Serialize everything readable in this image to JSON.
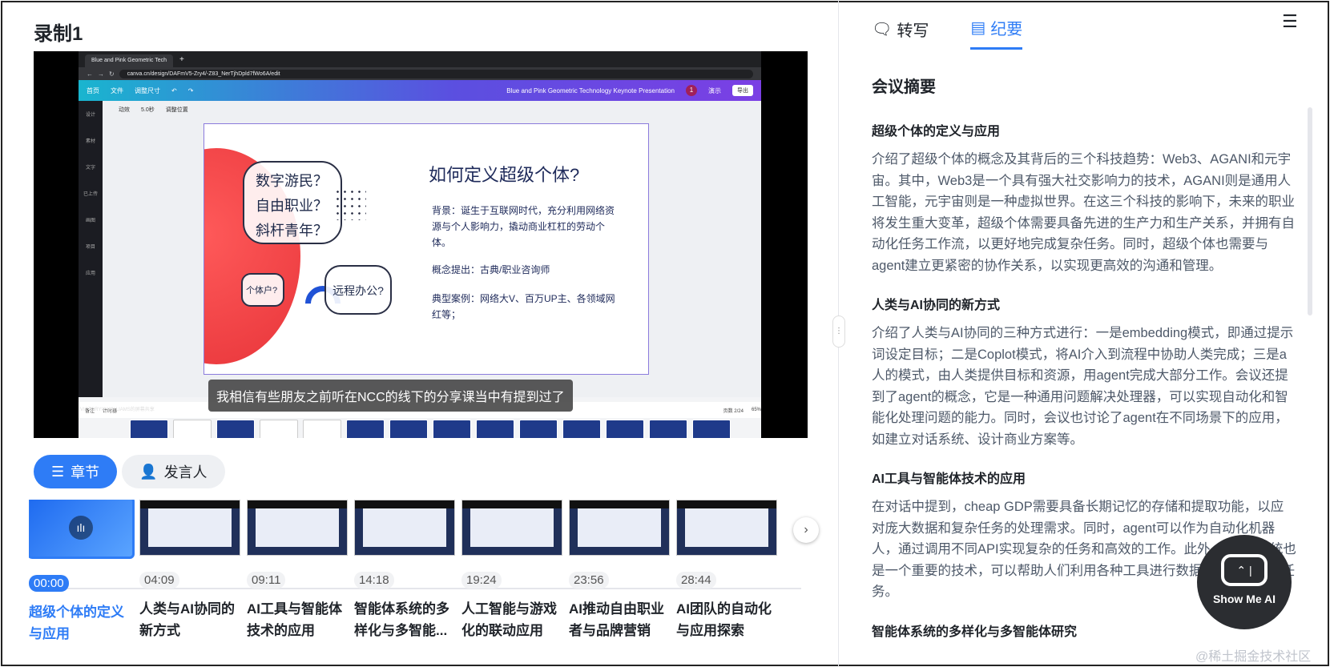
{
  "page": {
    "title": "录制1"
  },
  "browser": {
    "tab_title": "Blue and Pink Geometric Tech",
    "url": "canva.cn/design/DAFmV5-Zry4/-Z83_NerTjhDpld7fWo6A/edit",
    "toolbar": {
      "home": "首页",
      "file": "文件",
      "resize": "调整尺寸",
      "doc_title": "Blue and Pink Geometric Technology Keynote Presentation",
      "collab_count": "1",
      "present": "演示",
      "export": "导出"
    },
    "side_tools": [
      "设计",
      "素材",
      "文字",
      "已上传",
      "画图",
      "项目",
      "应用"
    ],
    "canvas_tools": {
      "animate": "动效",
      "duration": "5.0秒",
      "position": "调整位置"
    },
    "slide": {
      "bubble_lines": [
        "数字游民？",
        "自由职业？",
        "斜杆青年？"
      ],
      "small_bubble": "个体户?",
      "mid_bubble": "远程办公?",
      "heading": "如何定义超级个体?",
      "background": "背景：诞生于互联网时代，充分利用网络资源与个人影响力，撬动商业杠杠的劳动个体。",
      "concept": "概念提出：古典/职业咨询师",
      "cases": "典型案例：网络大V、百万UP主、各领域网红等；"
    },
    "footer": {
      "notes": "备注",
      "timer": "计时器",
      "page": "页数 2/24",
      "zoom": "65%"
    },
    "watermark": "VICTORYU_WILLIAMS的屏幕共享"
  },
  "subtitle": "我相信有些朋友之前听在NCC的线下的分享课当中有提到过了",
  "segments": {
    "chapters": "章节",
    "speakers": "发言人"
  },
  "chapters": [
    {
      "time": "00:00",
      "title": "超级个体的定义与应用"
    },
    {
      "time": "04:09",
      "title": "人类与AI协同的新方式"
    },
    {
      "time": "09:11",
      "title": "AI工具与智能体技术的应用"
    },
    {
      "time": "14:18",
      "title": "智能体系统的多样化与多智能..."
    },
    {
      "time": "19:24",
      "title": "人工智能与游戏化的联动应用"
    },
    {
      "time": "23:56",
      "title": "AI推动自由职业者与品牌营销"
    },
    {
      "time": "28:44",
      "title": "AI团队的自动化与应用探索"
    }
  ],
  "right": {
    "tabs": {
      "transcript": "转写",
      "minutes": "纪要"
    },
    "summary_title": "会议摘要",
    "sections": [
      {
        "title": "超级个体的定义与应用",
        "body": "介绍了超级个体的概念及其背后的三个科技趋势：Web3、AGANI和元宇宙。其中，Web3是一个具有强大社交影响力的技术，AGANI则是通用人工智能，元宇宙则是一种虚拟世界。在这三个科技的影响下，未来的职业将发生重大变革，超级个体需要具备先进的生产力和生产关系，并拥有自动化任务工作流，以更好地完成复杂任务。同时，超级个体也需要与agent建立更紧密的协作关系，以实现更高效的沟通和管理。"
      },
      {
        "title": "人类与AI协同的新方式",
        "body": "介绍了人类与AI协同的三种方式进行：一是embedding模式，即通过提示词设定目标；二是Coplot模式，将AI介入到流程中协助人类完成；三是a人的模式，由人类提供目标和资源，用agent完成大部分工作。会议还提到了agent的概念，它是一种通用问题解决处理器，可以实现自动化和智能化处理问题的能力。同时，会议也讨论了agent在不同场景下的应用，如建立对话系统、设计商业方案等。"
      },
      {
        "title": "AI工具与智能体技术的应用",
        "body": "在对话中提到，cheap GDP需要具备长期记忆的存储和提取功能，以应对庞大数据和复杂任务的处理需求。同时，agent可以作为自动化机器人，通过调用不同API实现复杂的任务和高效的工作。此外，agent系统也是一个重要的技术，可以帮助人们利用各种工具进行数据分析、预测等任务。"
      },
      {
        "title": "智能体系统的多样化与多智能体研究",
        "body": ""
      }
    ]
  },
  "floating": {
    "label": "Show Me AI"
  },
  "credit": "@稀土掘金技术社区"
}
